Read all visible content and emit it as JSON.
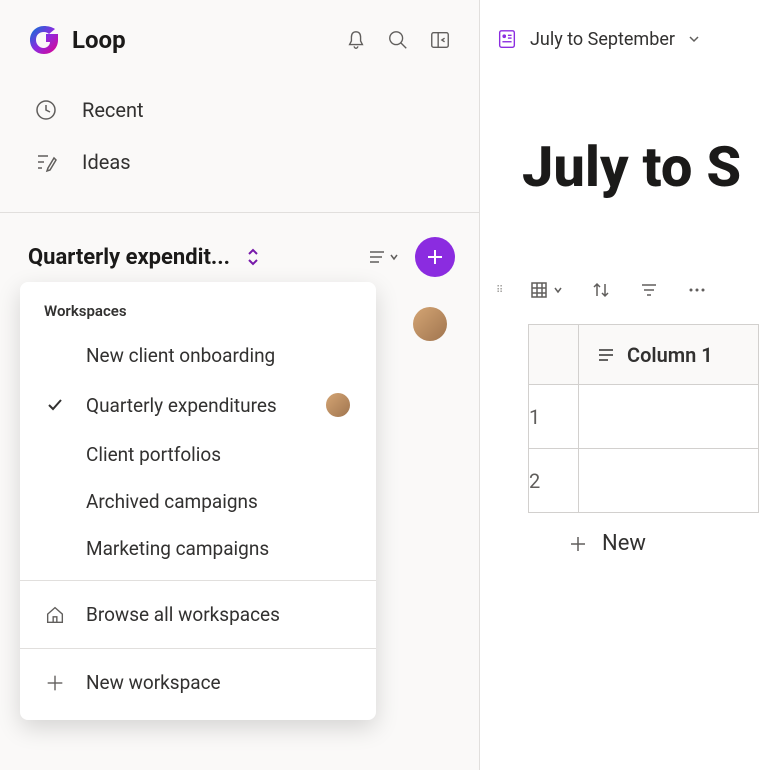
{
  "app": {
    "name": "Loop"
  },
  "nav": {
    "recent": "Recent",
    "ideas": "Ideas"
  },
  "workspace": {
    "current_truncated": "Quarterly expendit...",
    "dropdown": {
      "label": "Workspaces",
      "items": [
        {
          "label": "New client onboarding",
          "selected": false
        },
        {
          "label": "Quarterly expenditures",
          "selected": true
        },
        {
          "label": "Client portfolios",
          "selected": false
        },
        {
          "label": "Archived campaigns",
          "selected": false
        },
        {
          "label": "Marketing campaigns",
          "selected": false
        }
      ],
      "browse_all": "Browse all workspaces",
      "new_workspace": "New workspace"
    }
  },
  "page": {
    "breadcrumb": "July to September",
    "title": "July to S"
  },
  "table": {
    "column1_label": "Column 1",
    "rows": [
      "1",
      "2"
    ],
    "new_label": "New"
  }
}
